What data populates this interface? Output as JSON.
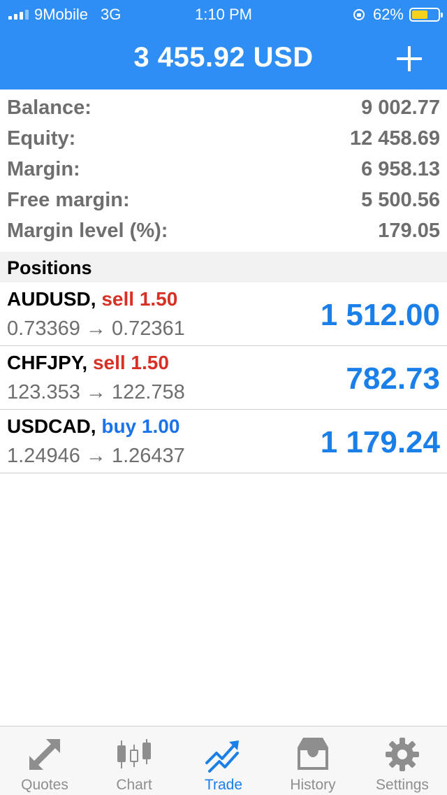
{
  "status_bar": {
    "carrier": "9Mobile",
    "network": "3G",
    "time": "1:10 PM",
    "battery": "62%",
    "battery_level": 0.62
  },
  "header": {
    "title": "3 455.92 USD"
  },
  "summary": [
    {
      "label": "Balance:",
      "value": "9 002.77"
    },
    {
      "label": "Equity:",
      "value": "12 458.69"
    },
    {
      "label": "Margin:",
      "value": "6 958.13"
    },
    {
      "label": "Free margin:",
      "value": "5 500.56"
    },
    {
      "label": "Margin level (%):",
      "value": "179.05"
    }
  ],
  "positions": {
    "title": "Positions",
    "items": [
      {
        "symbol": "AUDUSD,",
        "type": "sell 1.50",
        "prices": "0.73369 → 0.72361",
        "profit": "1 512.00"
      },
      {
        "symbol": "CHFJPY,",
        "type": "sell 1.50",
        "prices": "123.353 → 122.758",
        "profit": "782.73"
      },
      {
        "symbol": "USDCAD,",
        "type": "buy 1.00",
        "prices": "1.24946 → 1.26437",
        "profit": "1 179.24"
      }
    ]
  },
  "tabs": [
    {
      "label": "Quotes",
      "icon": "quotes-icon"
    },
    {
      "label": "Chart",
      "icon": "chart-icon"
    },
    {
      "label": "Trade",
      "icon": "trade-icon",
      "active": true
    },
    {
      "label": "History",
      "icon": "history-icon"
    },
    {
      "label": "Settings",
      "icon": "settings-icon"
    }
  ],
  "colors": {
    "header": "#2f8ef4",
    "sell": "#d93025",
    "buy": "#1a73e8",
    "profit": "#1a7fe8",
    "tab_active": "#1a7fe8"
  }
}
